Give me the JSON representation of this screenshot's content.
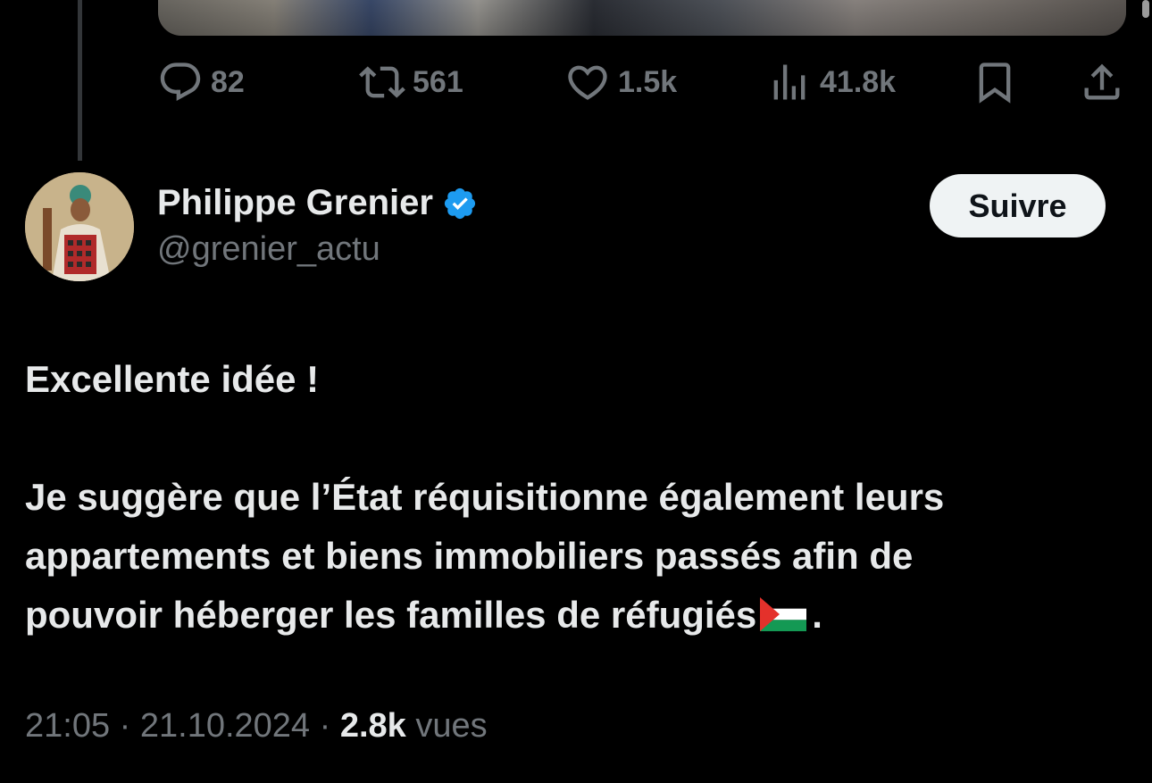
{
  "actions": {
    "reply_count": "82",
    "retweet_count": "561",
    "like_count": "1.5k",
    "views_count": "41.8k"
  },
  "author": {
    "name": "Philippe Grenier",
    "handle": "@grenier_actu",
    "verified": true,
    "follow_label": "Suivre"
  },
  "tweet": {
    "line1": "Excellente idée !",
    "line2a": "Je suggère que l’État réquisitionne également leurs",
    "line2b": "appartements et biens immobiliers passés afin de",
    "line2c": "pouvoir héberger les familles de réfugiés",
    "line2_end": ".",
    "time": "21:05",
    "date": "21.10.2024",
    "views": "2.8k",
    "views_label": "vues"
  },
  "colors": {
    "background": "#000000",
    "text": "#e7e9ea",
    "muted": "#71767b",
    "verified_blue": "#1d9bf0",
    "button_bg": "#eff3f4"
  },
  "icons": [
    "reply-icon",
    "retweet-icon",
    "like-icon",
    "views-icon",
    "bookmark-icon",
    "share-icon",
    "verified-badge-icon",
    "palestine-flag-icon"
  ]
}
